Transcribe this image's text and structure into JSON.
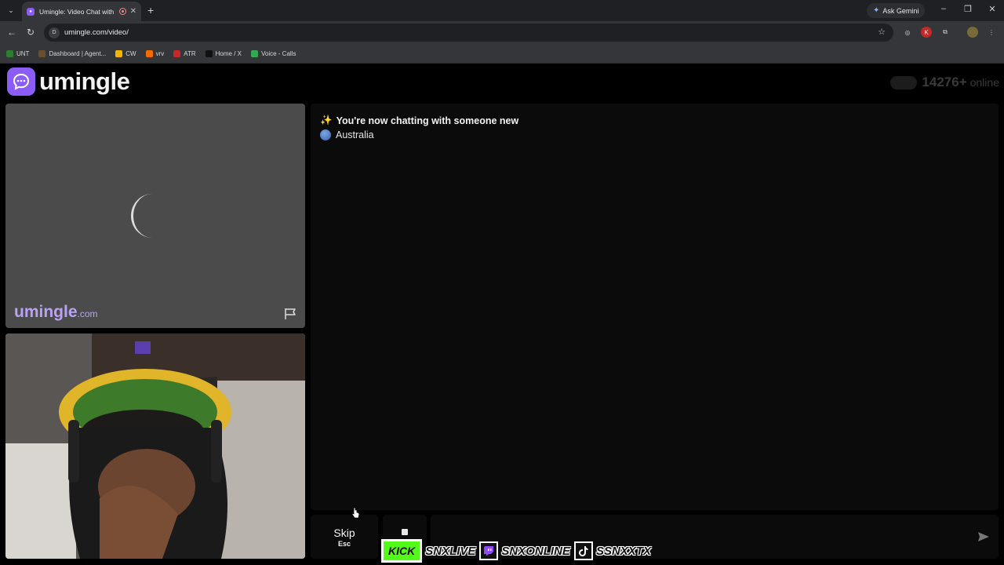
{
  "browser": {
    "tab_title": "Umingle: Video Chat with S",
    "tab_close": "✕",
    "new_tab": "+",
    "ask_gemini": "Ask Gemini",
    "url": "umingle.com/video/",
    "bookmarks": [
      {
        "label": "UNT",
        "color": "#2e7d32"
      },
      {
        "label": "Dashboard | Agent...",
        "color": "#6b4f2a"
      },
      {
        "label": "CW",
        "color": "#f4b400"
      },
      {
        "label": "vrv",
        "color": "#f56b00"
      },
      {
        "label": "ATR",
        "color": "#c62828"
      },
      {
        "label": "Home / X",
        "color": "#111111"
      },
      {
        "label": "Voice - Calls",
        "color": "#34a853"
      }
    ]
  },
  "page": {
    "logo_text": "umingle",
    "online_count": "14276+",
    "online_label": "online",
    "watermark_name": "umingle",
    "watermark_domain": ".com",
    "chat": {
      "system_message": "You're now chatting with someone new",
      "sparkle": "✨",
      "country": "Australia"
    },
    "skip_label": "Skip",
    "skip_key": "Esc",
    "message_placeholder": "",
    "social": {
      "kick_label": "KICK",
      "handles": [
        "SNXLIVE",
        "SNXONLINE",
        "SSNXXTX"
      ]
    }
  },
  "colors": {
    "brand": "#8b5cf6",
    "kick_green": "#53fc18",
    "watermark": "#b9a2f4"
  }
}
